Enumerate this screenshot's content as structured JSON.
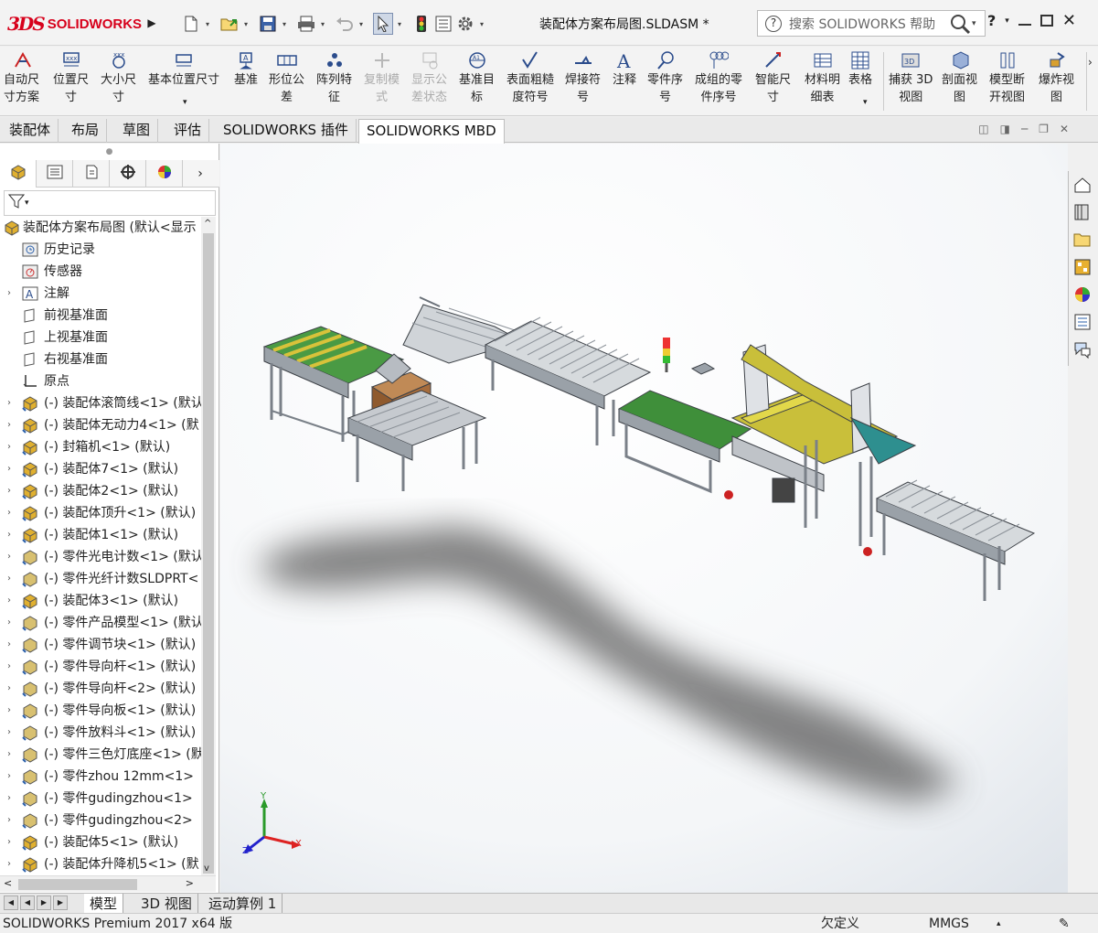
{
  "app": {
    "brand": "SOLIDWORKS",
    "brand_mark": "3DS",
    "document_title": "装配体方案布局图.SLDASM *",
    "help_search_placeholder": "搜索 SOLIDWORKS 帮助",
    "help_label": "?"
  },
  "quickbar": {
    "icons": [
      "new-document-icon",
      "open-icon",
      "save-icon",
      "print-icon",
      "undo-icon",
      "select-arrow-icon",
      "rebuild-icon",
      "file-properties-icon",
      "options-gear-icon"
    ]
  },
  "ribbon": {
    "buttons": [
      {
        "label": "自动尺\n寸方案",
        "icon": "auto-dimension-icon",
        "enabled": true
      },
      {
        "label": "位置尺\n寸",
        "icon": "location-dimension-icon",
        "enabled": true
      },
      {
        "label": "大小尺\n寸",
        "icon": "size-dimension-icon",
        "enabled": true
      },
      {
        "label": "基本位置尺寸",
        "icon": "basic-location-dimension-icon",
        "enabled": true
      },
      {
        "label": "基准",
        "icon": "datum-icon",
        "enabled": true
      },
      {
        "label": "形位公\n差",
        "icon": "geometric-tolerance-icon",
        "enabled": true
      },
      {
        "label": "阵列特\n征",
        "icon": "pattern-feature-icon",
        "enabled": true
      },
      {
        "label": "复制模\n式",
        "icon": "copy-scheme-icon",
        "enabled": false
      },
      {
        "label": "显示公\n差状态",
        "icon": "show-tolerance-status-icon",
        "enabled": false
      },
      {
        "label": "基准目\n标",
        "icon": "datum-target-icon",
        "enabled": true
      },
      {
        "label": "表面粗糙\n度符号",
        "icon": "surface-finish-icon",
        "enabled": true
      },
      {
        "label": "焊接符\n号",
        "icon": "weld-symbol-icon",
        "enabled": true
      },
      {
        "label": "注释",
        "icon": "note-icon",
        "enabled": true
      },
      {
        "label": "零件序\n号",
        "icon": "balloon-icon",
        "enabled": true
      },
      {
        "label": "成组的零\n件序号",
        "icon": "stacked-balloon-icon",
        "enabled": true
      },
      {
        "label": "智能尺\n寸",
        "icon": "smart-dimension-icon",
        "enabled": true
      },
      {
        "label": "材料明\n细表",
        "icon": "bom-icon",
        "enabled": true
      },
      {
        "label": "表格",
        "icon": "table-icon",
        "enabled": true
      },
      {
        "label": "捕获 3D\n视图",
        "icon": "capture-3d-view-icon",
        "enabled": true
      },
      {
        "label": "剖面视\n图",
        "icon": "section-view-icon",
        "enabled": true
      },
      {
        "label": "模型断\n开视图",
        "icon": "model-break-view-icon",
        "enabled": true
      },
      {
        "label": "爆炸视\n图",
        "icon": "exploded-view-icon",
        "enabled": true
      }
    ]
  },
  "tabs": [
    "装配体",
    "布局",
    "草图",
    "评估",
    "SOLIDWORKS 插件",
    "SOLIDWORKS MBD"
  ],
  "active_tab": "SOLIDWORKS MBD",
  "panel_tabs": [
    "feature-manager-icon",
    "property-manager-icon",
    "configuration-manager-icon",
    "dimxpert-manager-icon",
    "display-manager-icon"
  ],
  "tree": {
    "root": "装配体方案布局图 (默认<显示",
    "items": [
      {
        "label": "历史记录",
        "icon": "history-icon",
        "expand": false
      },
      {
        "label": "传感器",
        "icon": "sensor-icon",
        "expand": false
      },
      {
        "label": "注解",
        "icon": "annotation-icon",
        "expand": true
      },
      {
        "label": "前视基准面",
        "icon": "plane-icon",
        "expand": false
      },
      {
        "label": "上视基准面",
        "icon": "plane-icon",
        "expand": false
      },
      {
        "label": "右视基准面",
        "icon": "plane-icon",
        "expand": false
      },
      {
        "label": "原点",
        "icon": "origin-icon",
        "expand": false
      },
      {
        "label": "(-) 装配体滚筒线<1> (默认",
        "icon": "assembly-icon",
        "expand": true
      },
      {
        "label": "(-) 装配体无动力4<1> (默",
        "icon": "assembly-icon",
        "expand": true
      },
      {
        "label": "(-) 封箱机<1> (默认)",
        "icon": "assembly-icon",
        "expand": true
      },
      {
        "label": "(-) 装配体7<1> (默认)",
        "icon": "assembly-icon",
        "expand": true
      },
      {
        "label": "(-) 装配体2<1> (默认)",
        "icon": "assembly-icon",
        "expand": true
      },
      {
        "label": "(-) 装配体顶升<1> (默认)",
        "icon": "assembly-icon",
        "expand": true
      },
      {
        "label": "(-) 装配体1<1> (默认)",
        "icon": "assembly-icon",
        "expand": true
      },
      {
        "label": "(-) 零件光电计数<1> (默认",
        "icon": "part-icon",
        "expand": true
      },
      {
        "label": "(-) 零件光纤计数SLDPRT<",
        "icon": "part-icon",
        "expand": true
      },
      {
        "label": "(-) 装配体3<1> (默认)",
        "icon": "assembly-icon",
        "expand": true
      },
      {
        "label": "(-) 零件产品模型<1> (默认",
        "icon": "part-icon",
        "expand": true
      },
      {
        "label": "(-) 零件调节块<1> (默认)",
        "icon": "part-icon",
        "expand": true
      },
      {
        "label": "(-) 零件导向杆<1> (默认)",
        "icon": "part-icon",
        "expand": true
      },
      {
        "label": "(-) 零件导向杆<2> (默认)",
        "icon": "part-icon",
        "expand": true
      },
      {
        "label": "(-) 零件导向板<1> (默认)",
        "icon": "part-icon",
        "expand": true
      },
      {
        "label": "(-) 零件放料斗<1> (默认)",
        "icon": "part-icon",
        "expand": true
      },
      {
        "label": "(-) 零件三色灯底座<1> (默",
        "icon": "part-icon",
        "expand": true
      },
      {
        "label": "(-) 零件zhou  12mm<1>",
        "icon": "part-icon",
        "expand": true
      },
      {
        "label": "(-) 零件gudingzhou<1>",
        "icon": "part-icon",
        "expand": true
      },
      {
        "label": "(-) 零件gudingzhou<2>",
        "icon": "part-icon",
        "expand": true
      },
      {
        "label": "(-) 装配体5<1> (默认)",
        "icon": "assembly-icon",
        "expand": true
      },
      {
        "label": "(-) 装配体升降机5<1> (默",
        "icon": "assembly-icon",
        "expand": true
      }
    ]
  },
  "bottom_tabs": [
    "模型",
    "3D 视图",
    "运动算例 1"
  ],
  "active_bottom_tab": "模型",
  "status": {
    "product": "SOLIDWORKS Premium 2017 x64 版",
    "definition": "欠定义",
    "units": "MMGS"
  },
  "triad": {
    "x": "X",
    "y": "Y",
    "z": "Z"
  },
  "heads_up_icons": [
    "zoom-to-fit-icon",
    "zoom-to-area-icon",
    "previous-view-icon",
    "section-view-icon",
    "dynamic-annotation-icon",
    "view-orientation-icon",
    "display-style-icon",
    "hide-show-icon",
    "edit-appearance-icon",
    "apply-scene-icon",
    "view-settings-icon"
  ],
  "task_pane_icons": [
    "home-icon",
    "design-library-icon",
    "file-explorer-icon",
    "view-palette-icon",
    "appearances-icon",
    "custom-properties-icon",
    "forum-icon"
  ],
  "colors": {
    "brand_red": "#d7001b",
    "accent_green": "#3f8f3a",
    "frame_grey": "#8a8f96",
    "box_brown": "#a0683c",
    "guide_yellow": "#c9bf3a",
    "rail_orange": "#e8891c"
  }
}
